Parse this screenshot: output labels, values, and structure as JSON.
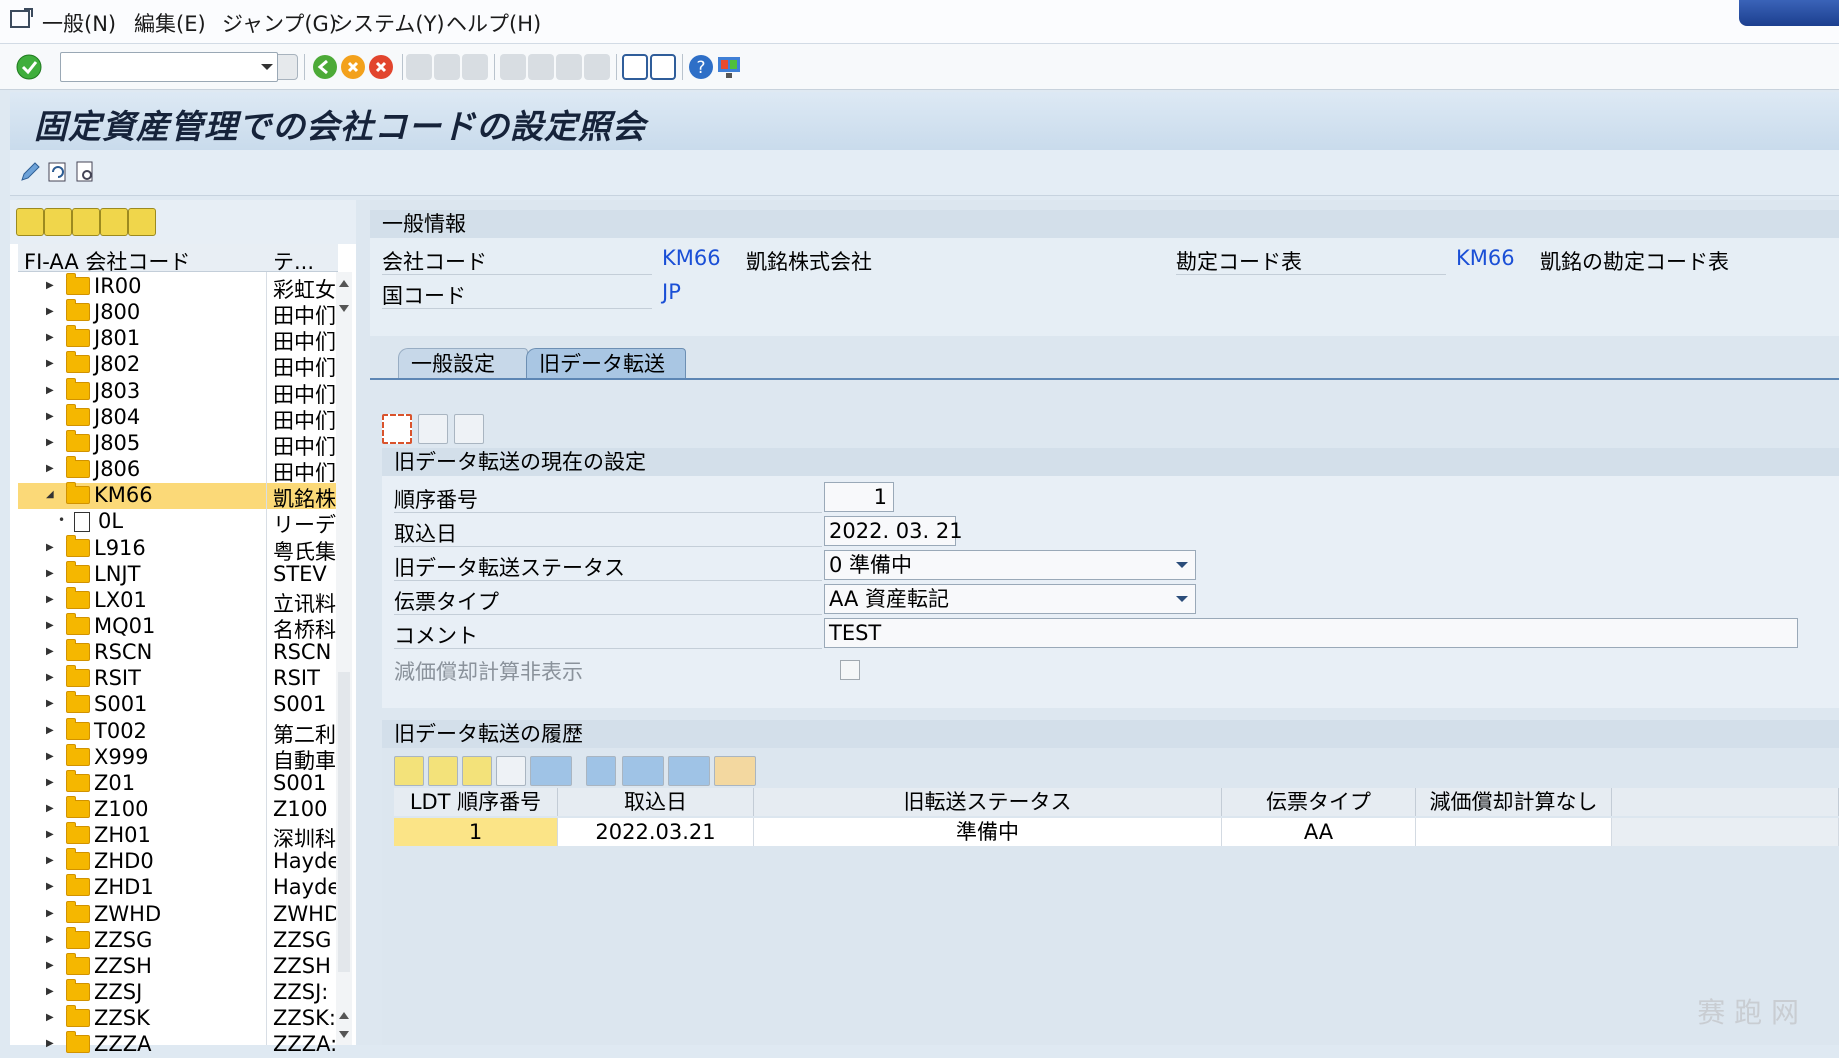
{
  "menu": [
    "一般(N)",
    "編集(E)",
    "ジャンプ(G)",
    "システム(Y)",
    "ヘルプ(H)"
  ],
  "title": "固定資産管理での会社コードの設定照会",
  "tree": {
    "headers": [
      "FI-AA 会社コード",
      "テ..."
    ],
    "rows": [
      {
        "code": "IR00",
        "desc": "彩虹女",
        "expanded": false
      },
      {
        "code": "J800",
        "desc": "田中们",
        "expanded": false
      },
      {
        "code": "J801",
        "desc": "田中们",
        "expanded": false
      },
      {
        "code": "J802",
        "desc": "田中们",
        "expanded": false
      },
      {
        "code": "J803",
        "desc": "田中们",
        "expanded": false
      },
      {
        "code": "J804",
        "desc": "田中们",
        "expanded": false
      },
      {
        "code": "J805",
        "desc": "田中们",
        "expanded": false
      },
      {
        "code": "J806",
        "desc": "田中们",
        "expanded": false
      },
      {
        "code": "KM66",
        "desc": "凱銘株",
        "expanded": true,
        "selected": true
      },
      {
        "code": "0L",
        "desc": "リーディ",
        "child": true
      },
      {
        "code": "L916",
        "desc": "粤氏集",
        "expanded": false
      },
      {
        "code": "LNJT",
        "desc": "STEV",
        "expanded": false
      },
      {
        "code": "LX01",
        "desc": "立讯料",
        "expanded": false
      },
      {
        "code": "MQ01",
        "desc": "名桥科",
        "expanded": false
      },
      {
        "code": "RSCN",
        "desc": "RSCN",
        "expanded": false
      },
      {
        "code": "RSIT",
        "desc": "RSIT",
        "expanded": false
      },
      {
        "code": "S001",
        "desc": "S001",
        "expanded": false
      },
      {
        "code": "T002",
        "desc": "第二利",
        "expanded": false
      },
      {
        "code": "X999",
        "desc": "自動車",
        "expanded": false
      },
      {
        "code": "Z01",
        "desc": "S001",
        "expanded": false
      },
      {
        "code": "Z100",
        "desc": "Z100",
        "expanded": false
      },
      {
        "code": "ZH01",
        "desc": "深圳科",
        "expanded": false
      },
      {
        "code": "ZHD0",
        "desc": "Hayde",
        "expanded": false
      },
      {
        "code": "ZHD1",
        "desc": "Hayde",
        "expanded": false
      },
      {
        "code": "ZWHD",
        "desc": "ZWHD",
        "expanded": false
      },
      {
        "code": "ZZSG",
        "desc": "ZZSG",
        "expanded": false
      },
      {
        "code": "ZZSH",
        "desc": "ZZSH",
        "expanded": false
      },
      {
        "code": "ZZSJ",
        "desc": "ZZSJ:",
        "expanded": false
      },
      {
        "code": "ZZSK",
        "desc": "ZZSK:",
        "expanded": false
      },
      {
        "code": "ZZZA",
        "desc": "ZZZA:",
        "expanded": false
      }
    ]
  },
  "general_info": {
    "heading": "一般情報",
    "company_code_label": "会社コード",
    "company_code": "KM66",
    "company_name": "凱銘株式会社",
    "coa_label": "勘定コード表",
    "coa": "KM66",
    "coa_name": "凱銘の勘定コード表",
    "country_label": "国コード",
    "country": "JP"
  },
  "tabs": [
    "一般設定",
    "旧データ転送"
  ],
  "current": {
    "heading": "旧データ転送の現在の設定",
    "seq_label": "順序番号",
    "seq_value": "1",
    "date_label": "取込日",
    "date_value": "2022. 03. 21",
    "status_label": "旧データ転送ステータス",
    "status_value": "0 準備中",
    "doctype_label": "伝票タイプ",
    "doctype_value": "AA 資産転記",
    "comment_label": "コメント",
    "comment_value": "TEST",
    "nodep_label": "減価償却計算非表示"
  },
  "history": {
    "heading": "旧データ転送の履歴",
    "columns": [
      "LDT 順序番号",
      "取込日",
      "旧転送ステータス",
      "伝票タイプ",
      "減価償却計算なし"
    ],
    "rows": [
      [
        "1",
        "2022.03.21",
        "準備中",
        "AA",
        ""
      ]
    ]
  },
  "watermark": "赛 跑 网"
}
